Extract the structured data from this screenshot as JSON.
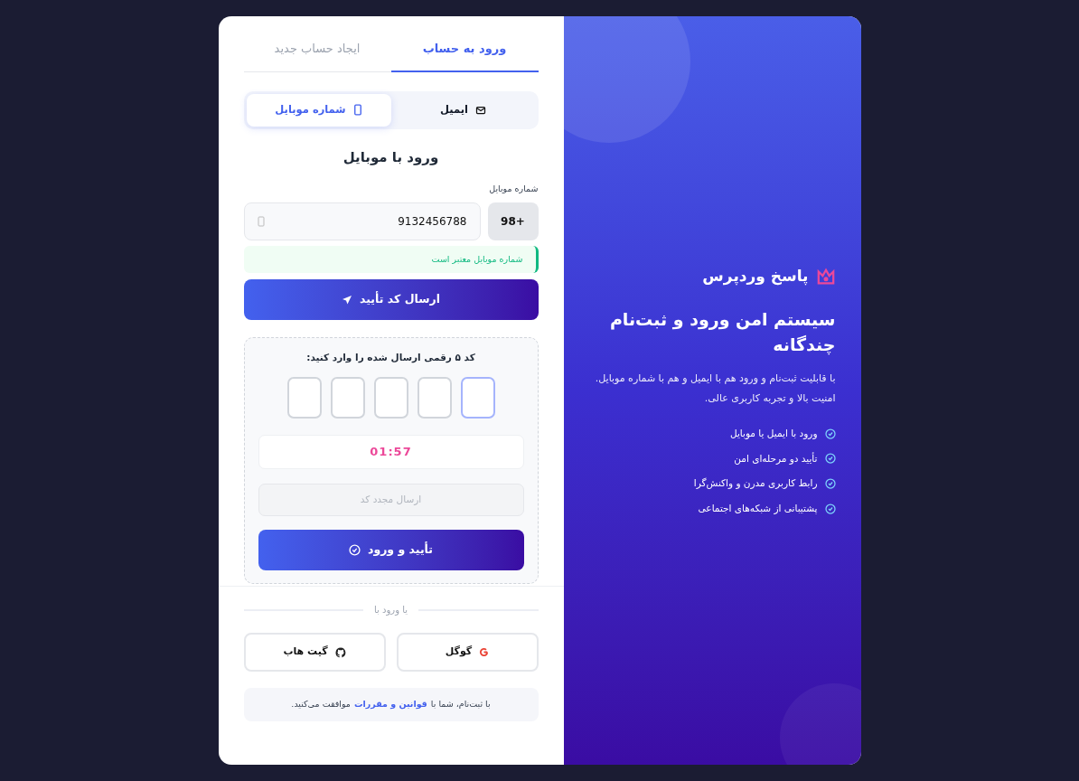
{
  "tabs": [
    {
      "label": "ورود به حساب",
      "selected": true
    },
    {
      "label": "ایجاد حساب جدید",
      "selected": false
    }
  ],
  "methods": [
    {
      "label": "ایمیل",
      "kind": "email",
      "selected": false
    },
    {
      "label": "شماره موبایل",
      "kind": "mobile",
      "selected": true
    }
  ],
  "form": {
    "title": "ورود با موبایل",
    "phone_label": "شماره موبایل",
    "country_code": "98+",
    "phone_value": "9132456788",
    "validation": "شماره موبایل معتبر است",
    "send_button": "ارسال کد تأیید"
  },
  "otp": {
    "prompt": "کد ۵ رقمی ارسال شده را وارد کنید:",
    "boxes": [
      {
        "focused": true
      },
      {
        "focused": false
      },
      {
        "focused": false
      },
      {
        "focused": false
      },
      {
        "focused": false
      }
    ],
    "timer": "01:57",
    "resend": {
      "label": "ارسال مجدد کد",
      "disabled": true
    },
    "confirm_button": "تأیید و ورود"
  },
  "social": {
    "divider": "یا ورود با",
    "buttons": [
      {
        "label": "گوگل",
        "kind": "google"
      },
      {
        "label": "گیت هاب",
        "kind": "github"
      }
    ]
  },
  "terms": {
    "before": "با ثبت‌نام، شما با",
    "link": "قوانین و مقررات",
    "after": "موافقت می‌کنید."
  },
  "hero": {
    "brand": "پاسخ وردپرس",
    "title": "سیستم امن ورود و ثبت‌نام چندگانه",
    "description": "با قابلیت ثبت‌نام و ورود هم با ایمیل و هم با شماره موبایل. امنیت بالا و تجربه کاربری عالی.",
    "features": [
      "ورود با ایمیل یا موبایل",
      "تأیید دو مرحله‌ای امن",
      "رابط کاربری مدرن و واکنش‌گرا",
      "پشتیبانی از شبکه‌های اجتماعی"
    ]
  }
}
